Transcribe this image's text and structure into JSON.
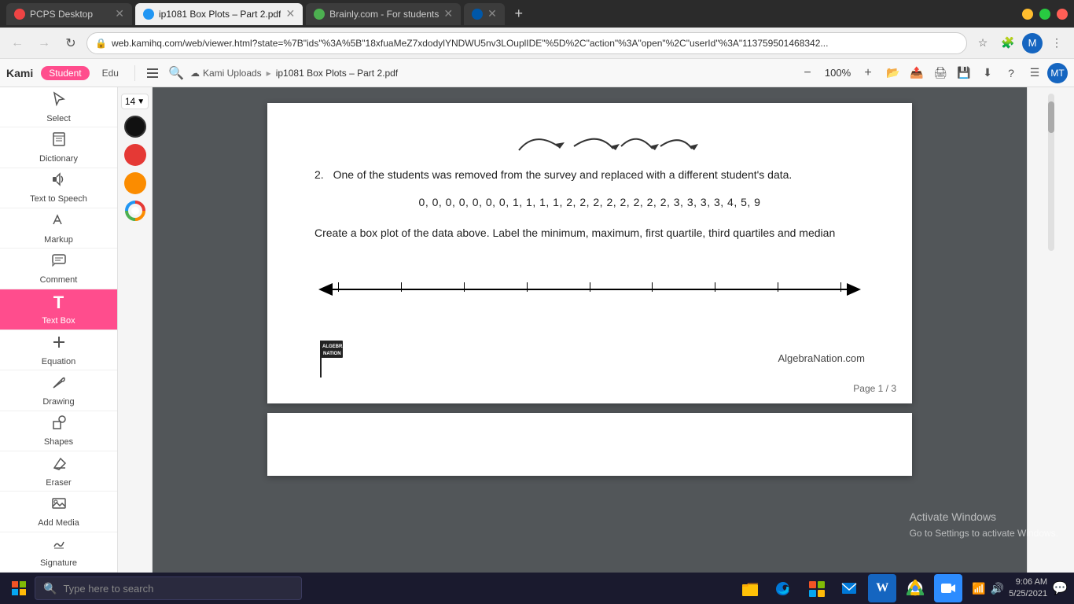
{
  "browser": {
    "tabs": [
      {
        "id": "tab1",
        "label": "PCPS Desktop",
        "favicon_color": "#e44",
        "active": false
      },
      {
        "id": "tab2",
        "label": "ip1081 Box Plots – Part 2.pdf",
        "favicon_color": "#2196F3",
        "active": true
      },
      {
        "id": "tab3",
        "label": "Brainly.com - For students",
        "favicon_color": "#4CAF50",
        "active": false
      }
    ],
    "address": "web.kamihq.com/web/viewer.html?state=%7B\"ids\"%3A%5B\"18xfuaMeZ7xdodylYNDWU5nv3LOuplIDE\"%5D%2C\"action\"%3A\"open\"%2C\"userId\"%3A\"113759501468342...",
    "zoom": "100%"
  },
  "kami": {
    "logo": "Kami",
    "student_btn": "Student",
    "edu_btn": "Edu",
    "uploads_label": "Kami Uploads",
    "breadcrumb_sep": "▸",
    "file_name": "ip1081 Box Plots – Part 2.pdf",
    "zoom_level": "100%"
  },
  "sidebar": {
    "items": [
      {
        "id": "select",
        "label": "Select",
        "icon": "⊹"
      },
      {
        "id": "dictionary",
        "label": "Dictionary",
        "icon": "📖"
      },
      {
        "id": "tts",
        "label": "Text to Speech",
        "icon": "🔊"
      },
      {
        "id": "markup",
        "label": "Markup",
        "icon": "✎"
      },
      {
        "id": "comment",
        "label": "Comment",
        "icon": "💬"
      },
      {
        "id": "textbox",
        "label": "Text Box",
        "icon": "T",
        "active": true
      },
      {
        "id": "equation",
        "label": "Equation",
        "icon": "±"
      },
      {
        "id": "drawing",
        "label": "Drawing",
        "icon": "✏️"
      },
      {
        "id": "shapes",
        "label": "Shapes",
        "icon": "◻"
      },
      {
        "id": "eraser",
        "label": "Eraser",
        "icon": "⌫"
      },
      {
        "id": "addmedia",
        "label": "Add Media",
        "icon": "🖼"
      },
      {
        "id": "signature",
        "label": "Signature",
        "icon": "✍"
      }
    ]
  },
  "colors": {
    "font_size": "14",
    "swatches": [
      {
        "color": "#111111",
        "selected": true
      },
      {
        "color": "#e53935",
        "selected": false
      },
      {
        "color": "#fb8c00",
        "selected": false
      }
    ],
    "palette_icon": "🎨"
  },
  "document": {
    "question_number": "2.",
    "question_text": "One of the students was removed from the survey and replaced with a different student's data.",
    "data_values": "0, 0, 0, 0, 0, 0, 0, 1, 1, 1, 1, 2, 2, 2, 2, 2, 2, 2, 2, 3, 3, 3, 3, 4, 5, 9",
    "instruction_text": "Create a box plot of the data above. Label the minimum, maximum, first quartile, third quartiles and median",
    "watermark": "AlgebraNation.com",
    "page_info": "Page   1   / 3"
  },
  "taskbar": {
    "search_placeholder": "Type here to search",
    "apps": [
      {
        "name": "file-explorer",
        "icon": "📁",
        "color": "#FFC107"
      },
      {
        "name": "edge",
        "icon": "🌐",
        "color": "#0078D7"
      },
      {
        "name": "store",
        "icon": "🛍",
        "color": "#0078D7"
      },
      {
        "name": "mail",
        "icon": "✉",
        "color": "#0078D7"
      },
      {
        "name": "word",
        "icon": "W",
        "color": "#1565C0"
      },
      {
        "name": "chrome",
        "icon": "⬤",
        "color": "#4CAF50"
      },
      {
        "name": "zoom",
        "icon": "Z",
        "color": "#2196F3"
      }
    ],
    "time": "9:06 AM",
    "date": "5/25/2021"
  },
  "activate_windows": {
    "title": "Activate Windows",
    "subtitle": "Go to Settings to activate Windows."
  }
}
